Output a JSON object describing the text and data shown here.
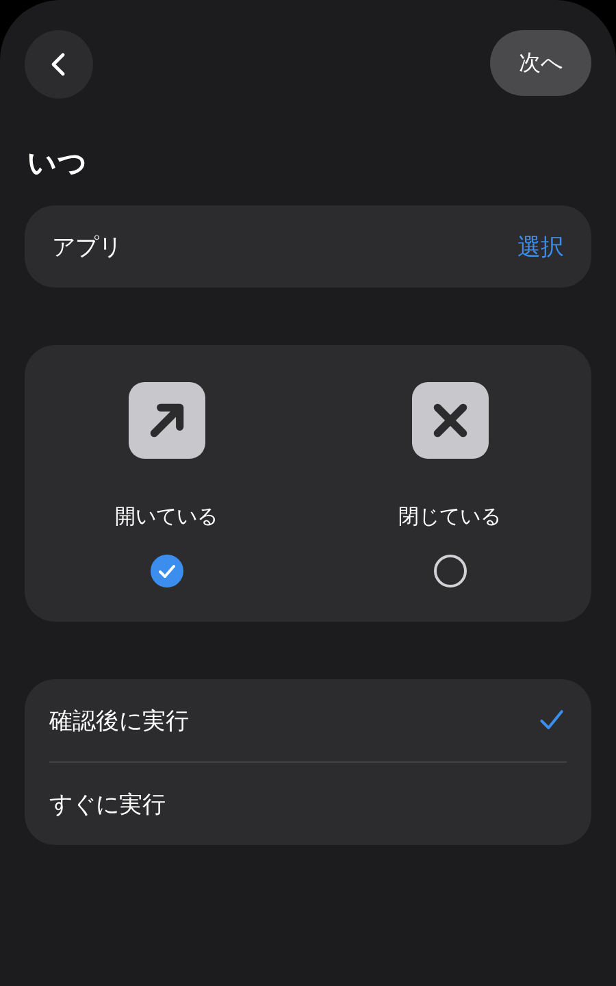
{
  "header": {
    "next_button": "次へ"
  },
  "title": "いつ",
  "app_row": {
    "label": "アプリ",
    "action": "選択"
  },
  "states": [
    {
      "kind": "open",
      "label": "開いている",
      "selected": true
    },
    {
      "kind": "closed",
      "label": "閉じている",
      "selected": false
    }
  ],
  "run_options": [
    {
      "label": "確認後に実行",
      "selected": true
    },
    {
      "label": "すぐに実行",
      "selected": false
    }
  ]
}
